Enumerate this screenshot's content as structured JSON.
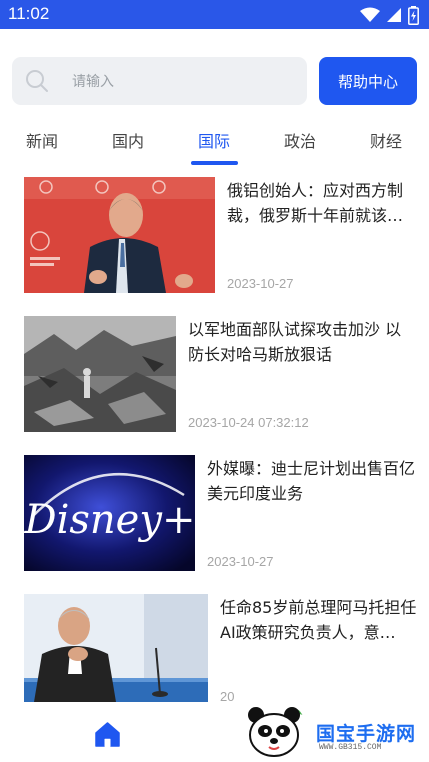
{
  "status_bar": {
    "time": "11:02"
  },
  "search": {
    "placeholder": "请输入",
    "help_label": "帮助中心"
  },
  "tabs": [
    {
      "label": "新闻"
    },
    {
      "label": "国内"
    },
    {
      "label": "国际",
      "active": true
    },
    {
      "label": "政治"
    },
    {
      "label": "财经"
    }
  ],
  "news": [
    {
      "title": "俄铝创始人：应对西方制裁，俄罗斯十年前就该…",
      "date": "2023-10-27"
    },
    {
      "title": "以军地面部队试探攻击加沙 以防长对哈马斯放狠话",
      "date": "2023-10-24 07:32:12"
    },
    {
      "title": "外媒曝：迪士尼计划出售百亿美元印度业务",
      "date": "2023-10-27",
      "image_text": "Disney+"
    },
    {
      "title": "任命85岁前总理阿马托担任AI政策研究负责人，意…",
      "date": "20"
    }
  ],
  "watermark": {
    "brand": "国宝手游网",
    "url": "WWW.GB315.COM"
  },
  "colors": {
    "accent": "#1f57f0",
    "status_bar": "#2a57e8",
    "search_bg": "#eef0f3"
  }
}
